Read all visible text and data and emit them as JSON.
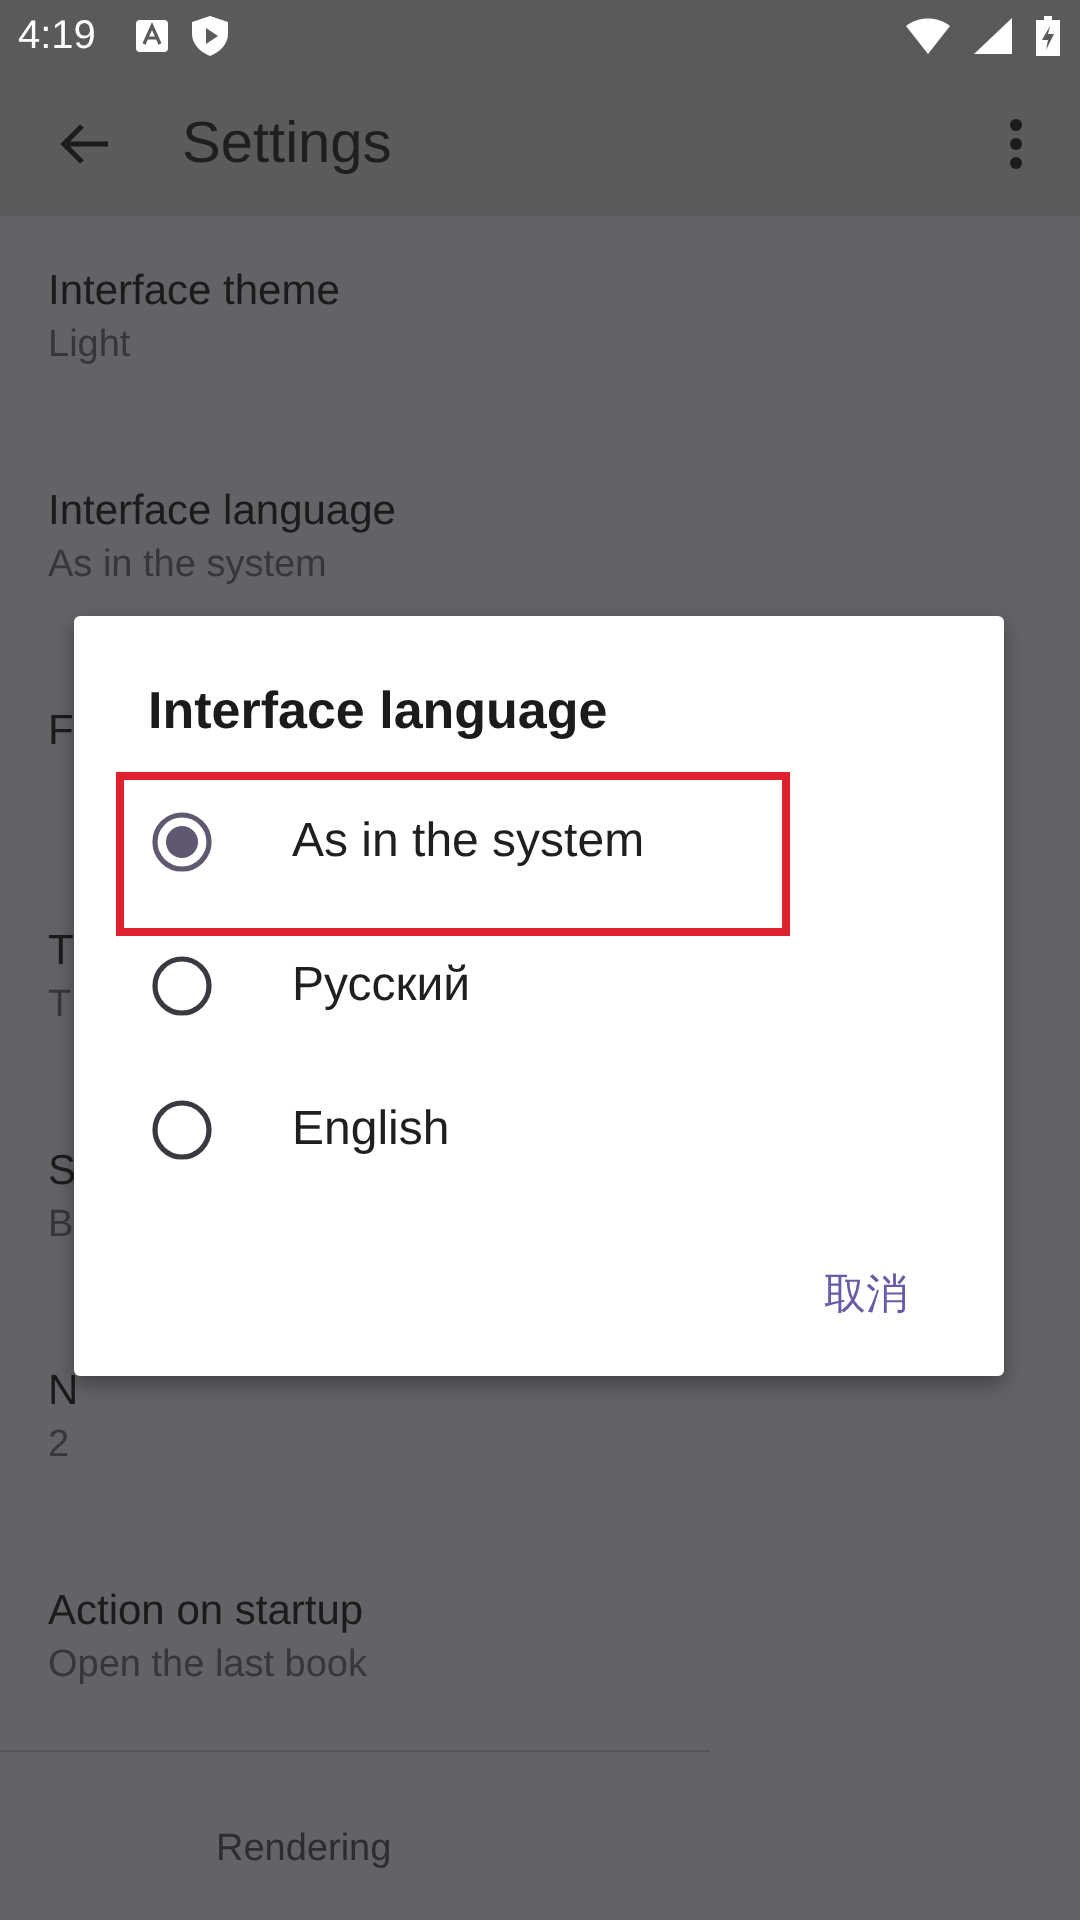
{
  "status_bar": {
    "time": "4:19"
  },
  "app_bar": {
    "title": "Settings"
  },
  "settings": [
    {
      "title": "Interface theme",
      "subtitle": "Light"
    },
    {
      "title": "Interface language",
      "subtitle": "As in the system"
    },
    {
      "title": "F"
    },
    {
      "title": "T",
      "subtitle": "T"
    },
    {
      "title": "S",
      "subtitle": "B"
    },
    {
      "title": "N",
      "subtitle": "2"
    },
    {
      "title": "Action on startup",
      "subtitle": "Open the last book"
    }
  ],
  "section_header": "Rendering",
  "dialog": {
    "title": "Interface language",
    "options": [
      {
        "label": "As in the system",
        "selected": true,
        "highlighted": true
      },
      {
        "label": "Русский",
        "selected": false,
        "highlighted": false
      },
      {
        "label": "English",
        "selected": false,
        "highlighted": false
      }
    ],
    "cancel_button": "取消"
  }
}
